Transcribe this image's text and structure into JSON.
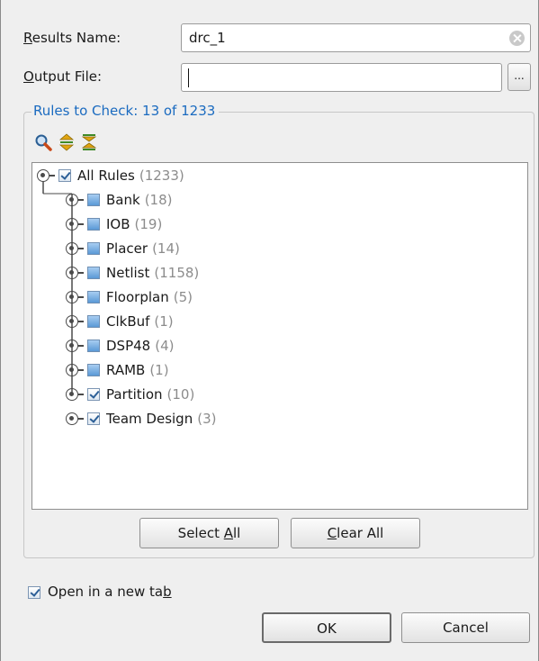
{
  "form": {
    "results_name": {
      "label_mnemonic": "R",
      "label_rest": "esults Name:",
      "value": "drc_1"
    },
    "output_file": {
      "label_mnemonic": "O",
      "label_rest": "utput File:",
      "value": "",
      "browse_label": "..."
    }
  },
  "rules": {
    "group_title": "Rules to Check: 13 of 1233",
    "toolbar": [
      "search-icon",
      "expand-all-icon",
      "collapse-all-icon"
    ],
    "root": {
      "label": "All Rules",
      "count": "(1233)",
      "state": "checked"
    },
    "items": [
      {
        "label": "Bank",
        "count": "(18)",
        "state": "partial"
      },
      {
        "label": "IOB",
        "count": "(19)",
        "state": "partial"
      },
      {
        "label": "Placer",
        "count": "(14)",
        "state": "partial"
      },
      {
        "label": "Netlist",
        "count": "(1158)",
        "state": "partial"
      },
      {
        "label": "Floorplan",
        "count": "(5)",
        "state": "partial"
      },
      {
        "label": "ClkBuf",
        "count": "(1)",
        "state": "partial"
      },
      {
        "label": "DSP48",
        "count": "(4)",
        "state": "partial"
      },
      {
        "label": "RAMB",
        "count": "(1)",
        "state": "partial"
      },
      {
        "label": "Partition",
        "count": "(10)",
        "state": "checked"
      },
      {
        "label": "Team Design",
        "count": "(3)",
        "state": "checked"
      }
    ],
    "select_all": {
      "pre": "Select ",
      "mnemonic": "A",
      "post": "ll"
    },
    "clear_all": {
      "pre": "",
      "mnemonic": "C",
      "post": "lear All"
    }
  },
  "open_in_new_tab": {
    "pre": "Open in a new ta",
    "mnemonic": "b",
    "checked": true
  },
  "buttons": {
    "ok": "OK",
    "cancel": "Cancel"
  },
  "colors": {
    "group_title": "#1b6bc0",
    "count_text": "#8c8c8c"
  }
}
